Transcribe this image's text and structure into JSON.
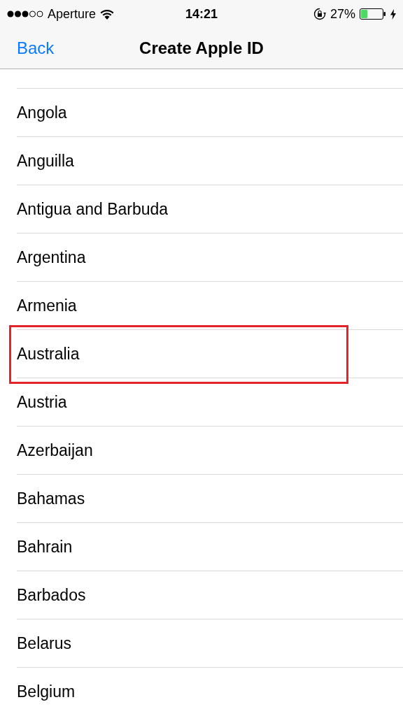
{
  "status_bar": {
    "carrier": "Aperture",
    "time": "14:21",
    "battery": "27%"
  },
  "nav_bar": {
    "back": "Back",
    "title": "Create Apple ID"
  },
  "countries": [
    {
      "name": "Angola",
      "highlighted": false
    },
    {
      "name": "Anguilla",
      "highlighted": false
    },
    {
      "name": "Antigua and Barbuda",
      "highlighted": false
    },
    {
      "name": "Argentina",
      "highlighted": false
    },
    {
      "name": "Armenia",
      "highlighted": false
    },
    {
      "name": "Australia",
      "highlighted": true
    },
    {
      "name": "Austria",
      "highlighted": false
    },
    {
      "name": "Azerbaijan",
      "highlighted": false
    },
    {
      "name": "Bahamas",
      "highlighted": false
    },
    {
      "name": "Bahrain",
      "highlighted": false
    },
    {
      "name": "Barbados",
      "highlighted": false
    },
    {
      "name": "Belarus",
      "highlighted": false
    },
    {
      "name": "Belgium",
      "highlighted": false
    }
  ]
}
